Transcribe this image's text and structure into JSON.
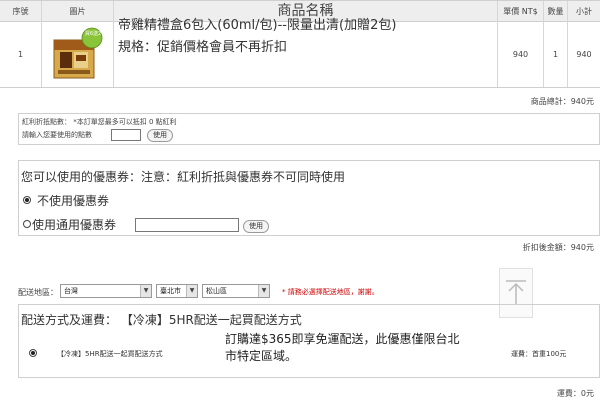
{
  "cart": {
    "headers": {
      "seq": "序號",
      "image": "圖片",
      "name": "商品名稱",
      "price": "單價 NT$",
      "qty": "數量",
      "subtotal": "小計"
    },
    "item": {
      "seq": "1",
      "name": "帝雞精禮盒6包入(60ml/包)--限量出清(加贈2包)",
      "spec": "規格：促銷價格會員不再折扣",
      "price": "940",
      "qty": "1",
      "subtotal": "940",
      "thumb_badge": "買6送2"
    },
    "total": "商品總計：940元"
  },
  "bonus": {
    "line1": "紅利折抵點數： *本訂單您最多可以抵扣 0 點紅利",
    "line2": "請輸入您要使用的點數",
    "button": "使用"
  },
  "coupon": {
    "title": "您可以使用的優惠券：注意：紅利折抵與優惠券不可同時使用",
    "opt_none": "不使用優惠券",
    "opt_general": "使用通用優惠券",
    "button": "使用"
  },
  "after_discount": "折扣後金額：940元",
  "shipping_region": {
    "label": "配送地區：",
    "country": "台灣",
    "city": "臺北市",
    "district": "松山區",
    "note": "* 請務必選擇配送地區，謝謝。"
  },
  "shipping": {
    "title": "配送方式及運費： 【冷凍】5HR配送一起買配送方式",
    "option": "【冷凍】5HR配送一起買配送方式",
    "promo": "訂購達$365即享免運配送，此優惠僅限台北市特定區域。",
    "fee_label": "運費：首重100元"
  },
  "shipping_fee": "運費：0元",
  "colors": {
    "note_red": "#cc0000",
    "header_bg": "#eeeeee",
    "border": "#cfcfcf"
  }
}
